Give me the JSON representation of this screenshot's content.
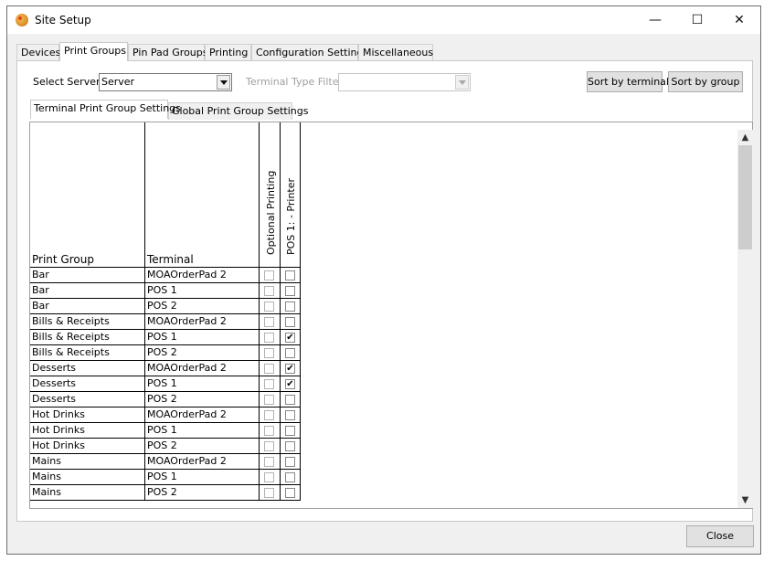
{
  "window": {
    "title": "Site Setup",
    "minimize": "—",
    "maximize": "☐",
    "close": "✕"
  },
  "main_tabs": [
    "Devices",
    "Print Groups",
    "Pin Pad Groups",
    "Printing",
    "Configuration Settings",
    "Miscellaneous"
  ],
  "active_main_tab": "Print Groups",
  "toolbar": {
    "select_server_label": "Select Server:",
    "server_value": "Server",
    "terminal_type_filter_label": "Terminal Type Filter:",
    "terminal_type_filter_value": "",
    "sort_by_terminal": "Sort by terminal",
    "sort_by_group": "Sort by group"
  },
  "sub_tabs": [
    "Terminal Print Group Settings",
    "Global Print Group Settings"
  ],
  "grid": {
    "headers": {
      "print_group": "Print Group",
      "terminal": "Terminal",
      "optional_printing": "Optional Printing",
      "printer": "POS 1: - Printer"
    },
    "rows": [
      {
        "group": "Bar",
        "terminal": "MOAOrderPad 2",
        "optional": false,
        "printer": false
      },
      {
        "group": "Bar",
        "terminal": "POS 1",
        "optional": false,
        "printer": false
      },
      {
        "group": "Bar",
        "terminal": "POS 2",
        "optional": false,
        "printer": false
      },
      {
        "group": "Bills & Receipts",
        "terminal": "MOAOrderPad 2",
        "optional": false,
        "printer": false
      },
      {
        "group": "Bills & Receipts",
        "terminal": "POS 1",
        "optional": false,
        "printer": true
      },
      {
        "group": "Bills & Receipts",
        "terminal": "POS 2",
        "optional": false,
        "printer": false
      },
      {
        "group": "Desserts",
        "terminal": "MOAOrderPad 2",
        "optional": false,
        "printer": true
      },
      {
        "group": "Desserts",
        "terminal": "POS 1",
        "optional": false,
        "printer": true
      },
      {
        "group": "Desserts",
        "terminal": "POS 2",
        "optional": false,
        "printer": false
      },
      {
        "group": "Hot Drinks",
        "terminal": "MOAOrderPad 2",
        "optional": false,
        "printer": false
      },
      {
        "group": "Hot Drinks",
        "terminal": "POS 1",
        "optional": false,
        "printer": false
      },
      {
        "group": "Hot Drinks",
        "terminal": "POS 2",
        "optional": false,
        "printer": false
      },
      {
        "group": "Mains",
        "terminal": "MOAOrderPad 2",
        "optional": false,
        "printer": false
      },
      {
        "group": "Mains",
        "terminal": "POS 1",
        "optional": false,
        "printer": false
      },
      {
        "group": "Mains",
        "terminal": "POS 2",
        "optional": false,
        "printer": false
      }
    ]
  },
  "scrollbar": {
    "up": "▲",
    "down": "▼"
  },
  "footer": {
    "close_label": "Close"
  }
}
